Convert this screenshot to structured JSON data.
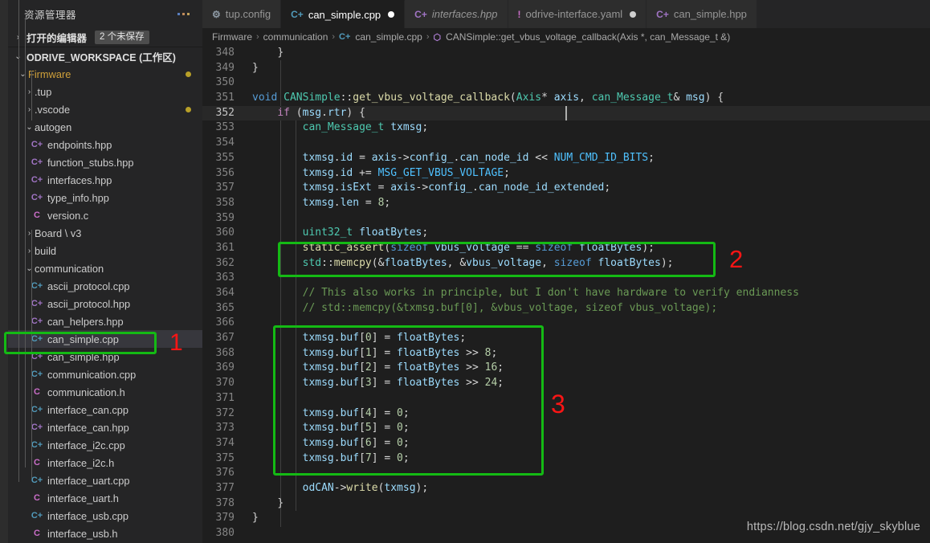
{
  "sidebar": {
    "title": "资源管理器",
    "more_icon": "ellipsis-icon",
    "open_editors": {
      "label": "打开的编辑器",
      "badge": "2 个未保存",
      "chevron": "›"
    },
    "workspace": {
      "label": "ODRIVE_WORKSPACE (工作区)",
      "chevron": "⌄"
    },
    "tree": [
      {
        "label": "Firmware",
        "type": "folder",
        "indent": 1,
        "expanded": true,
        "dirty": true,
        "accent": "#cfa03a"
      },
      {
        "label": ".tup",
        "type": "folder",
        "indent": 2,
        "expanded": false,
        "dirty": false
      },
      {
        "label": ".vscode",
        "type": "folder",
        "indent": 2,
        "expanded": false,
        "dirty": true
      },
      {
        "label": "autogen",
        "type": "folder",
        "indent": 2,
        "expanded": true,
        "dirty": false
      },
      {
        "label": "endpoints.hpp",
        "type": "hpp",
        "indent": 3,
        "icon": "C+"
      },
      {
        "label": "function_stubs.hpp",
        "type": "hpp",
        "indent": 3,
        "icon": "C+"
      },
      {
        "label": "interfaces.hpp",
        "type": "hpp",
        "indent": 3,
        "icon": "C+"
      },
      {
        "label": "type_info.hpp",
        "type": "hpp",
        "indent": 3,
        "icon": "C+"
      },
      {
        "label": "version.c",
        "type": "c",
        "indent": 3,
        "icon": "C"
      },
      {
        "label": "Board \\ v3",
        "type": "folder",
        "indent": 2,
        "expanded": false,
        "dirty": false
      },
      {
        "label": "build",
        "type": "folder",
        "indent": 2,
        "expanded": false,
        "dirty": false
      },
      {
        "label": "communication",
        "type": "folder",
        "indent": 2,
        "expanded": true,
        "dirty": false
      },
      {
        "label": "ascii_protocol.cpp",
        "type": "cpp",
        "indent": 3,
        "icon": "C+"
      },
      {
        "label": "ascii_protocol.hpp",
        "type": "hpp",
        "indent": 3,
        "icon": "C+"
      },
      {
        "label": "can_helpers.hpp",
        "type": "hpp",
        "indent": 3,
        "icon": "C+"
      },
      {
        "label": "can_simple.cpp",
        "type": "cpp",
        "indent": 3,
        "icon": "C+",
        "selected": true
      },
      {
        "label": "can_simple.hpp",
        "type": "hpp",
        "indent": 3,
        "icon": "C+"
      },
      {
        "label": "communication.cpp",
        "type": "cpp",
        "indent": 3,
        "icon": "C+"
      },
      {
        "label": "communication.h",
        "type": "c",
        "indent": 3,
        "icon": "C"
      },
      {
        "label": "interface_can.cpp",
        "type": "cpp",
        "indent": 3,
        "icon": "C+"
      },
      {
        "label": "interface_can.hpp",
        "type": "hpp",
        "indent": 3,
        "icon": "C+"
      },
      {
        "label": "interface_i2c.cpp",
        "type": "cpp",
        "indent": 3,
        "icon": "C+"
      },
      {
        "label": "interface_i2c.h",
        "type": "c",
        "indent": 3,
        "icon": "C"
      },
      {
        "label": "interface_uart.cpp",
        "type": "cpp",
        "indent": 3,
        "icon": "C+"
      },
      {
        "label": "interface_uart.h",
        "type": "c",
        "indent": 3,
        "icon": "C"
      },
      {
        "label": "interface_usb.cpp",
        "type": "cpp",
        "indent": 3,
        "icon": "C+"
      },
      {
        "label": "interface_usb.h",
        "type": "c",
        "indent": 3,
        "icon": "C"
      }
    ]
  },
  "tabs": [
    {
      "label": "tup.config",
      "icon": "gear-icon",
      "icon_glyph": "⚙",
      "icon_color": "#8f9ba6",
      "active": false,
      "dirty": false,
      "italic": false
    },
    {
      "label": "can_simple.cpp",
      "icon": "cpp-icon",
      "icon_glyph": "C+",
      "icon_color": "#519aba",
      "active": true,
      "dirty": true,
      "italic": false
    },
    {
      "label": "interfaces.hpp",
      "icon": "hpp-icon",
      "icon_glyph": "C+",
      "icon_color": "#a074c4",
      "active": false,
      "dirty": false,
      "italic": true
    },
    {
      "label": "odrive-interface.yaml",
      "icon": "yaml-icon",
      "icon_glyph": "!",
      "icon_color": "#cb6ec9",
      "active": false,
      "dirty": true,
      "italic": false
    },
    {
      "label": "can_simple.hpp",
      "icon": "hpp-icon",
      "icon_glyph": "C+",
      "icon_color": "#a074c4",
      "active": false,
      "dirty": false,
      "italic": false
    }
  ],
  "breadcrumb": [
    {
      "label": "Firmware",
      "icon": null
    },
    {
      "label": "communication",
      "icon": null
    },
    {
      "label": "can_simple.cpp",
      "icon": "cpp-icon",
      "icon_glyph": "C+",
      "icon_color": "#519aba"
    },
    {
      "label": "CANSimple::get_vbus_voltage_callback(Axis *, can_Message_t &)",
      "icon": "symbol-method-icon",
      "icon_glyph": "⬡",
      "icon_color": "#b180d7"
    }
  ],
  "code": {
    "first_line": 348,
    "active_line": 352,
    "lines": [
      {
        "n": 348,
        "text": "    }"
      },
      {
        "n": 349,
        "text": "}"
      },
      {
        "n": 350,
        "text": ""
      },
      {
        "n": 351,
        "text": "void CANSimple::get_vbus_voltage_callback(Axis* axis, can_Message_t& msg) {"
      },
      {
        "n": 352,
        "text": "    if (msg.rtr) {"
      },
      {
        "n": 353,
        "text": "        can_Message_t txmsg;"
      },
      {
        "n": 354,
        "text": ""
      },
      {
        "n": 355,
        "text": "        txmsg.id = axis->config_.can_node_id << NUM_CMD_ID_BITS;"
      },
      {
        "n": 356,
        "text": "        txmsg.id += MSG_GET_VBUS_VOLTAGE;"
      },
      {
        "n": 357,
        "text": "        txmsg.isExt = axis->config_.can_node_id_extended;"
      },
      {
        "n": 358,
        "text": "        txmsg.len = 8;"
      },
      {
        "n": 359,
        "text": ""
      },
      {
        "n": 360,
        "text": "        uint32_t floatBytes;"
      },
      {
        "n": 361,
        "text": "        static_assert(sizeof vbus_voltage == sizeof floatBytes);"
      },
      {
        "n": 362,
        "text": "        std::memcpy(&floatBytes, &vbus_voltage, sizeof floatBytes);"
      },
      {
        "n": 363,
        "text": ""
      },
      {
        "n": 364,
        "text": "        // This also works in principle, but I don't have hardware to verify endianness"
      },
      {
        "n": 365,
        "text": "        // std::memcpy(&txmsg.buf[0], &vbus_voltage, sizeof vbus_voltage);"
      },
      {
        "n": 366,
        "text": ""
      },
      {
        "n": 367,
        "text": "        txmsg.buf[0] = floatBytes;"
      },
      {
        "n": 368,
        "text": "        txmsg.buf[1] = floatBytes >> 8;"
      },
      {
        "n": 369,
        "text": "        txmsg.buf[2] = floatBytes >> 16;"
      },
      {
        "n": 370,
        "text": "        txmsg.buf[3] = floatBytes >> 24;"
      },
      {
        "n": 371,
        "text": ""
      },
      {
        "n": 372,
        "text": "        txmsg.buf[4] = 0;"
      },
      {
        "n": 373,
        "text": "        txmsg.buf[5] = 0;"
      },
      {
        "n": 374,
        "text": "        txmsg.buf[6] = 0;"
      },
      {
        "n": 375,
        "text": "        txmsg.buf[7] = 0;"
      },
      {
        "n": 376,
        "text": ""
      },
      {
        "n": 377,
        "text": "        odCAN->write(txmsg);"
      },
      {
        "n": 378,
        "text": "    }"
      },
      {
        "n": 379,
        "text": "}"
      },
      {
        "n": 380,
        "text": ""
      }
    ]
  },
  "annotations": {
    "color_box": "#14ba14",
    "color_number": "#fb1515",
    "items": [
      {
        "number": "1",
        "target": "sidebar-file-can_simple-cpp"
      },
      {
        "number": "2",
        "target": "code-lines-361-362"
      },
      {
        "number": "3",
        "target": "code-lines-367-375"
      }
    ]
  },
  "watermark": "https://blog.csdn.net/gjy_skyblue"
}
